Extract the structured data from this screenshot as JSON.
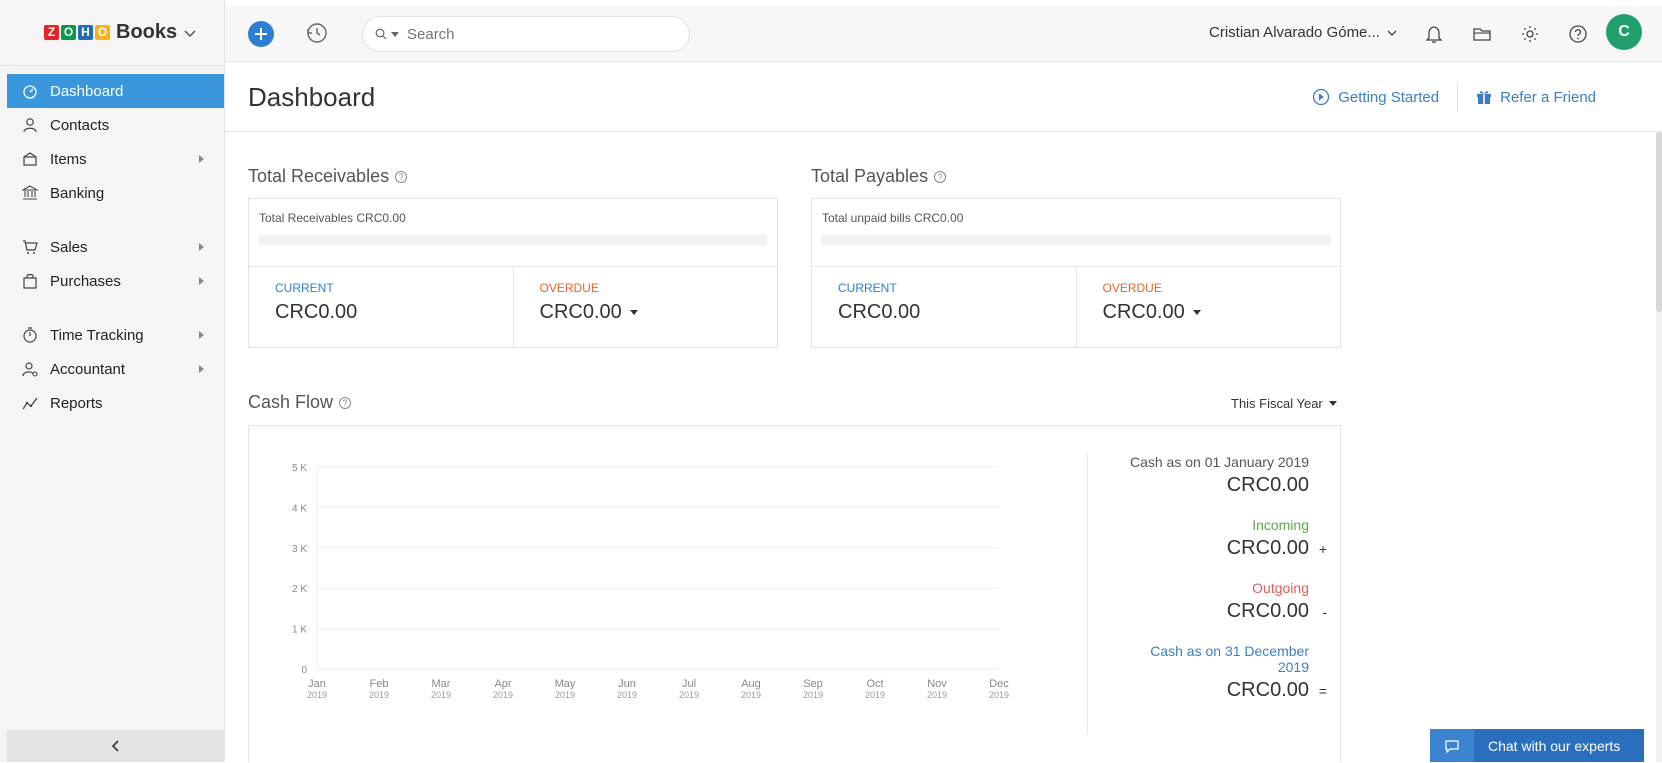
{
  "brand": {
    "logo_letters": [
      "Z",
      "O",
      "H",
      "O"
    ],
    "logo_colors": [
      "#e42527",
      "#089949",
      "#226db4",
      "#f9b21d"
    ],
    "name": "Books"
  },
  "sidebar": {
    "items": [
      {
        "label": "Dashboard",
        "icon": "dashboard-icon",
        "active": true
      },
      {
        "label": "Contacts",
        "icon": "contacts-icon"
      },
      {
        "label": "Items",
        "icon": "items-icon",
        "submenu": true
      },
      {
        "label": "Banking",
        "icon": "banking-icon"
      },
      {
        "label": "Sales",
        "icon": "sales-icon",
        "submenu": true
      },
      {
        "label": "Purchases",
        "icon": "purchases-icon",
        "submenu": true
      },
      {
        "label": "Time Tracking",
        "icon": "time-tracking-icon",
        "submenu": true
      },
      {
        "label": "Accountant",
        "icon": "accountant-icon",
        "submenu": true
      },
      {
        "label": "Reports",
        "icon": "reports-icon"
      }
    ],
    "collapse_icon": "chevron-left-icon"
  },
  "topbar": {
    "search_placeholder": "Search",
    "user_name": "Cristian Alvarado Góme...",
    "avatar_initial": "C"
  },
  "header": {
    "title": "Dashboard",
    "getting_started": "Getting Started",
    "refer_friend": "Refer a Friend"
  },
  "receivables": {
    "title": "Total Receivables",
    "summary": "Total Receivables CRC0.00",
    "current_label": "CURRENT",
    "current_value": "CRC0.00",
    "overdue_label": "OVERDUE",
    "overdue_value": "CRC0.00"
  },
  "payables": {
    "title": "Total Payables",
    "summary": "Total unpaid bills CRC0.00",
    "current_label": "CURRENT",
    "current_value": "CRC0.00",
    "overdue_label": "OVERDUE",
    "overdue_value": "CRC0.00"
  },
  "cashflow": {
    "title": "Cash Flow",
    "period": "This Fiscal Year",
    "opening_label": "Cash as on 01 January 2019",
    "opening_value": "CRC0.00",
    "incoming_label": "Incoming",
    "incoming_value": "CRC0.00",
    "incoming_op": "+",
    "outgoing_label": "Outgoing",
    "outgoing_value": "CRC0.00",
    "outgoing_op": "-",
    "closing_label_1": "Cash as on 31 December",
    "closing_label_2": "2019",
    "closing_value": "CRC0.00",
    "closing_op": "="
  },
  "chart_data": {
    "type": "line",
    "title": "",
    "xlabel": "",
    "ylabel": "",
    "y_ticks": [
      "0",
      "1 K",
      "2 K",
      "3 K",
      "4 K",
      "5 K"
    ],
    "ylim": [
      0,
      5000
    ],
    "x": [
      {
        "m": "Jan",
        "y": "2019"
      },
      {
        "m": "Feb",
        "y": "2019"
      },
      {
        "m": "Mar",
        "y": "2019"
      },
      {
        "m": "Apr",
        "y": "2019"
      },
      {
        "m": "May",
        "y": "2019"
      },
      {
        "m": "Jun",
        "y": "2019"
      },
      {
        "m": "Jul",
        "y": "2019"
      },
      {
        "m": "Aug",
        "y": "2019"
      },
      {
        "m": "Sep",
        "y": "2019"
      },
      {
        "m": "Oct",
        "y": "2019"
      },
      {
        "m": "Nov",
        "y": "2019"
      },
      {
        "m": "Dec",
        "y": "2019"
      }
    ],
    "series": [
      {
        "values": [
          0,
          0,
          0,
          0,
          0,
          0,
          0,
          0,
          0,
          0,
          0,
          0
        ]
      }
    ],
    "grid": true
  },
  "chat": {
    "label": "Chat with our experts"
  },
  "colors": {
    "accent": "#3a97de",
    "current": "#2d7fd6",
    "overdue": "#e6622b",
    "incoming": "#5aa94a",
    "outgoing": "#e05b5b"
  }
}
